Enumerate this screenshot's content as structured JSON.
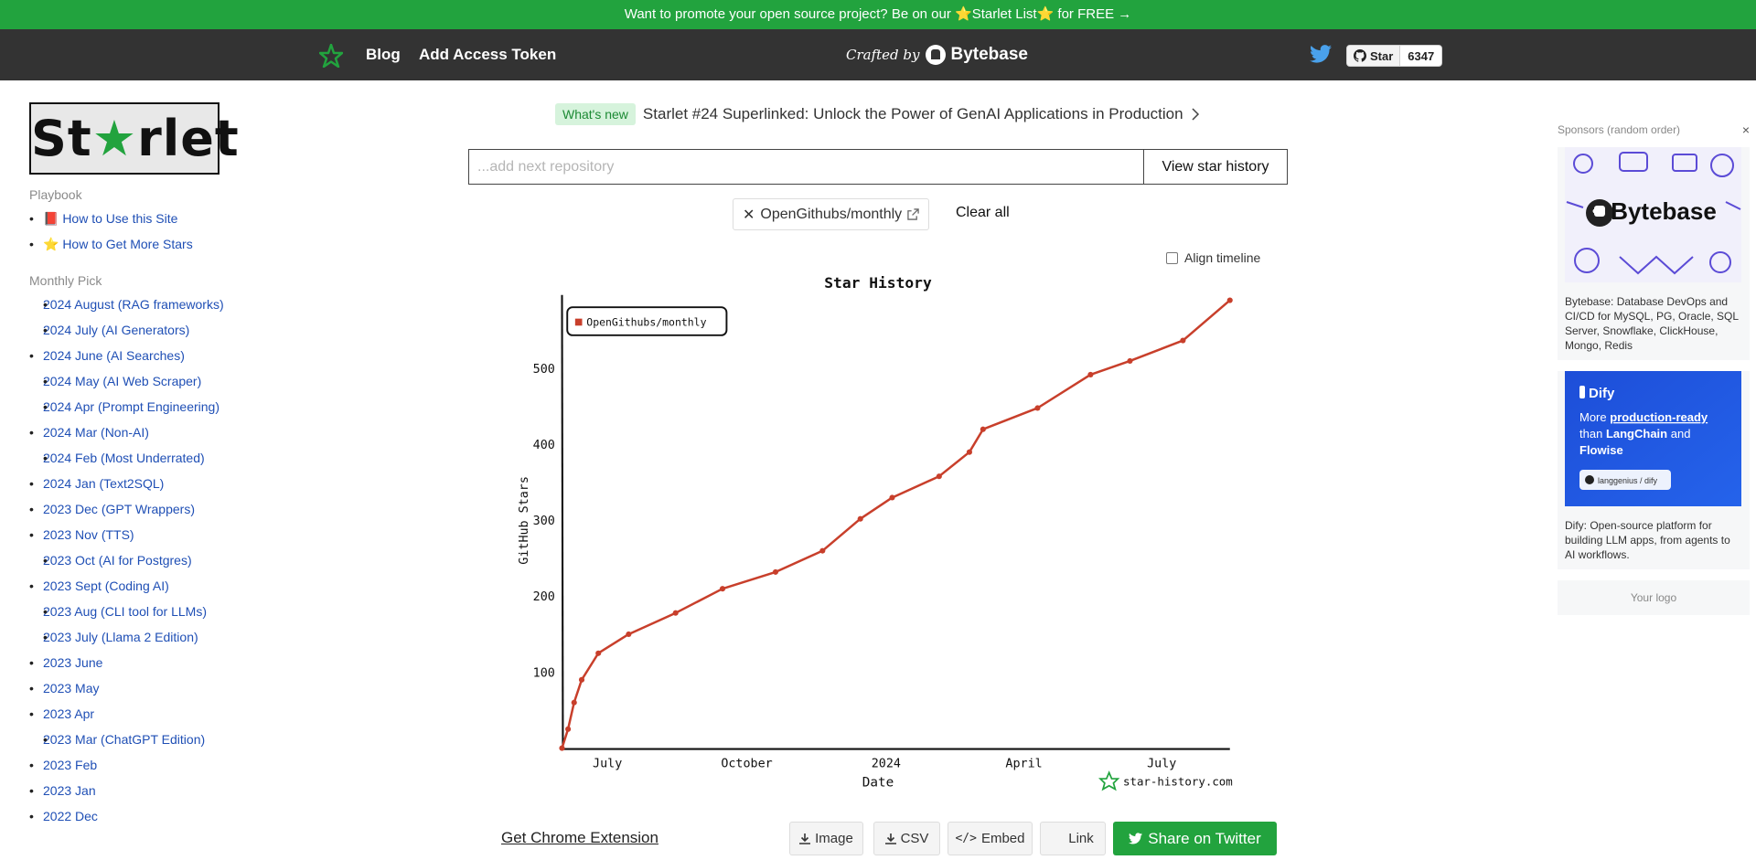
{
  "promo": {
    "text": "Want to promote your open source project? Be on our ⭐Starlet List⭐ for FREE →"
  },
  "nav": {
    "links": [
      "Blog",
      "Add Access Token"
    ],
    "crafted_by": "Crafted by",
    "brand": "Bytebase",
    "github_star_label": "Star",
    "github_star_count": "6347"
  },
  "sidebar": {
    "logo_text": "Starlet",
    "playbook_title": "Playbook",
    "playbook": [
      "📕 How to Use this Site",
      "⭐ How to Get More Stars"
    ],
    "monthly_title": "Monthly Pick",
    "monthly": [
      "2024 August (RAG frameworks)",
      "2024 July (AI Generators)",
      "2024 June (AI Searches)",
      "2024 May (AI Web Scraper)",
      "2024 Apr (Prompt Engineering)",
      "2024 Mar (Non-AI)",
      "2024 Feb (Most Underrated)",
      "2024 Jan (Text2SQL)",
      "2023 Dec (GPT Wrappers)",
      "2023 Nov (TTS)",
      "2023 Oct (AI for Postgres)",
      "2023 Sept (Coding AI)",
      "2023 Aug (CLI tool for LLMs)",
      "2023 July (Llama 2 Edition)",
      "2023 June",
      "2023 May",
      "2023 Apr",
      "2023 Mar (ChatGPT Edition)",
      "2023 Feb",
      "2023 Jan",
      "2022 Dec"
    ]
  },
  "main": {
    "whats_new_tag": "What's new",
    "whats_new_text": "Starlet #24 Superlinked: Unlock the Power of GenAI Applications in Production",
    "repo_placeholder": "...add next repository",
    "view_button": "View star history",
    "chip": "OpenGithubs/monthly",
    "clear_all": "Clear all",
    "align_timeline": "Align timeline",
    "chrome_extension": "Get Chrome Extension",
    "buttons": {
      "image": "Image",
      "csv": "CSV",
      "embed": "Embed",
      "link": "Link",
      "share": "Share on Twitter"
    }
  },
  "chart_data": {
    "type": "line",
    "title": "Star History",
    "xlabel": "Date",
    "ylabel": "GitHub Stars",
    "watermark": "star-history.com",
    "legend_placement": "top-left",
    "x_ticks": [
      "July",
      "October",
      "2024",
      "April",
      "July"
    ],
    "y_ticks": [
      100,
      200,
      300,
      400,
      500
    ],
    "ylim": [
      0,
      590
    ],
    "series": [
      {
        "name": "OpenGithubs/monthly",
        "color": "#c83f2b",
        "points": [
          [
            "2023-06-01",
            0
          ],
          [
            "2023-06-05",
            25
          ],
          [
            "2023-06-09",
            60
          ],
          [
            "2023-06-14",
            90
          ],
          [
            "2023-06-25",
            125
          ],
          [
            "2023-07-15",
            150
          ],
          [
            "2023-08-15",
            178
          ],
          [
            "2023-09-15",
            210
          ],
          [
            "2023-10-20",
            232
          ],
          [
            "2023-11-20",
            260
          ],
          [
            "2023-12-15",
            302
          ],
          [
            "2024-01-05",
            330
          ],
          [
            "2024-02-05",
            358
          ],
          [
            "2024-02-25",
            390
          ],
          [
            "2024-03-05",
            420
          ],
          [
            "2024-04-10",
            448
          ],
          [
            "2024-05-15",
            492
          ],
          [
            "2024-06-10",
            510
          ],
          [
            "2024-07-15",
            537
          ],
          [
            "2024-08-15",
            590
          ]
        ]
      }
    ]
  },
  "sponsors": {
    "title": "Sponsors (random order)",
    "close": "×",
    "items": [
      {
        "name": "Bytebase",
        "desc": "Bytebase: Database DevOps and CI/CD for MySQL, PG, Oracle, SQL Server, Snowflake, ClickHouse, Mongo, Redis"
      },
      {
        "name": "Dify",
        "desc": "Dify: Open-source platform for building LLM apps, from agents to AI workflows.",
        "banner_line1": "More",
        "banner_highlight": "production-ready",
        "banner_line2": "than",
        "banner_b1": "LangChain",
        "banner_and": "and",
        "banner_b2": "Flowise",
        "repo": "langgenius / dify"
      }
    ],
    "your_logo": "Your logo"
  },
  "colors": {
    "brand_green": "#22a33e",
    "nav_bg": "#333333",
    "link_blue": "#1f4fb5",
    "series_red": "#c83f2b"
  }
}
